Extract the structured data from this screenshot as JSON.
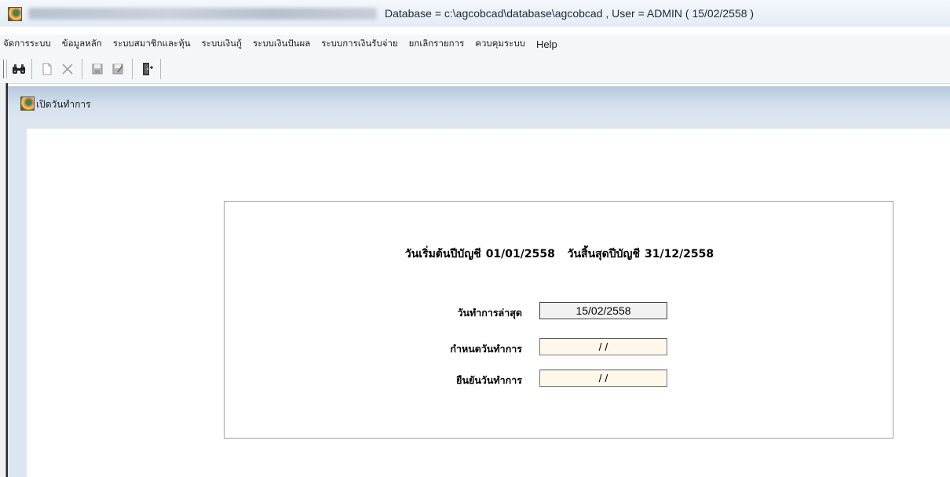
{
  "window": {
    "title": "Database = c:\\agcobcad\\database\\agcobcad , User = ADMIN ( 15/02/2558 )"
  },
  "menu": {
    "items": [
      "จัดการระบบ",
      "ข้อมูลหลัก",
      "ระบบสมาชิกและหุ้น",
      "ระบบเงินกู้",
      "ระบบเงินปันผล",
      "ระบบการเงินรับจ่าย",
      "ยกเลิกรายการ",
      "ควบคุมระบบ",
      "Help"
    ]
  },
  "toolbar": {
    "icons": [
      "search-icon",
      "new-document-icon",
      "delete-icon",
      "save-icon",
      "edit-save-icon",
      "exit-door-icon"
    ]
  },
  "child": {
    "title": "เปิดวันทำการ"
  },
  "form": {
    "period": {
      "start_label": "วันเริ่มต้นปีบัญชี",
      "start_date": "01/01/2558",
      "end_label": "วันสิ้นสุดปีบัญชี",
      "end_date": "31/12/2558"
    },
    "last_workday": {
      "label": "วันทำการล่าสุด",
      "value": "15/02/2558"
    },
    "set_workday": {
      "label": "กำหนดวันทำการ",
      "value": " / /"
    },
    "confirm_workday": {
      "label": "ยืนยันวันทำการ",
      "value": " / /"
    }
  },
  "colors": {
    "input_bg": "#fdf8ea",
    "child_titlebar": "#c9d8e8"
  }
}
